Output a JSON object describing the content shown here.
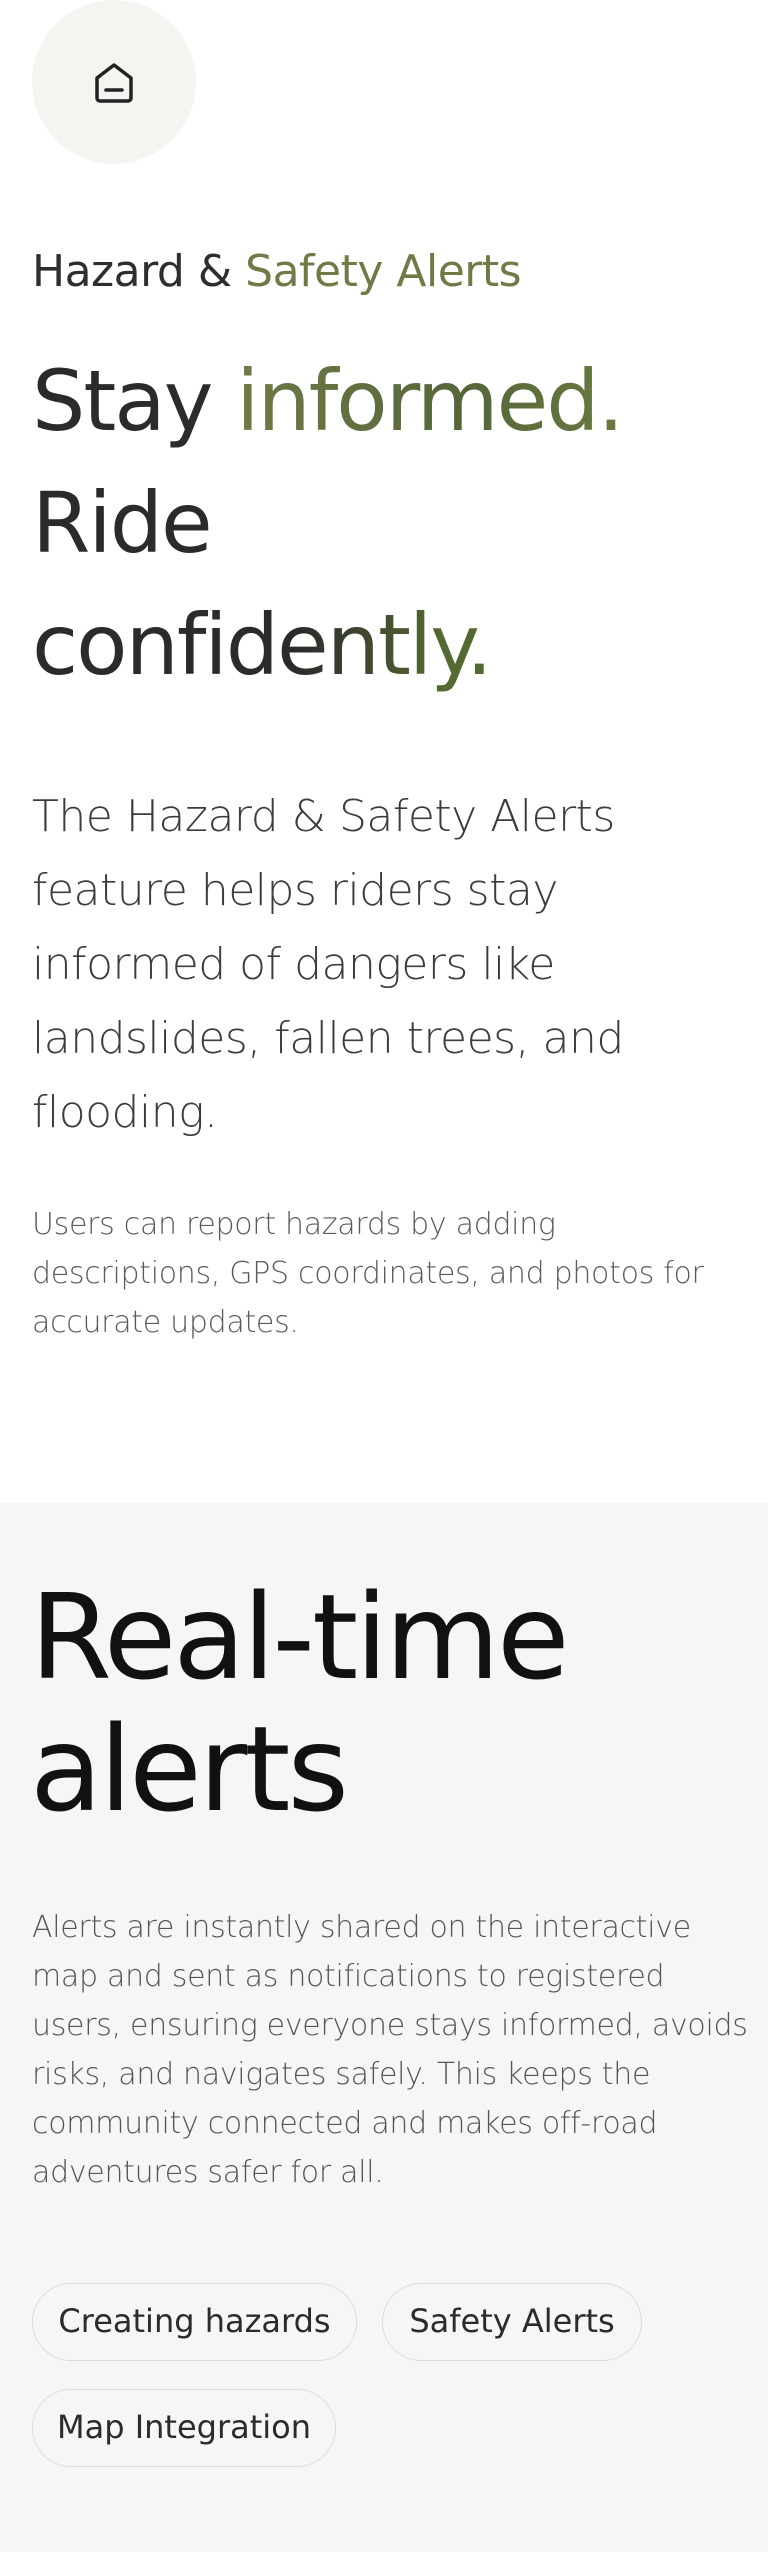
{
  "header": {
    "home_icon": "home-icon"
  },
  "hero": {
    "eyebrow_part1": "Hazard & ",
    "eyebrow_part2": "Safety Alerts",
    "headline_line1_a": "Stay ",
    "headline_line1_b": "informed.",
    "headline_line2": "Ride",
    "headline_line3": "confidently.",
    "lead": "The Hazard & Safety Alerts feature helps riders stay informed of dangers like landslides, fallen trees, and flooding.",
    "note": "Users can report hazards by adding descriptions, GPS coordinates, and photos for accurate updates."
  },
  "alerts": {
    "title": "Real-time alerts",
    "body": "Alerts are instantly shared on the interactive map and sent as notifications to registered users, ensuring everyone stays informed, avoids risks, and navigates safely. This keeps the community connected and makes off-road adventures safer for all.",
    "chips": [
      "Creating hazards",
      "Safety Alerts",
      "Map Integration"
    ]
  },
  "colors": {
    "accent": "#6f7a47",
    "text": "#2b2b2b",
    "section_bg": "#f6f6f6"
  }
}
